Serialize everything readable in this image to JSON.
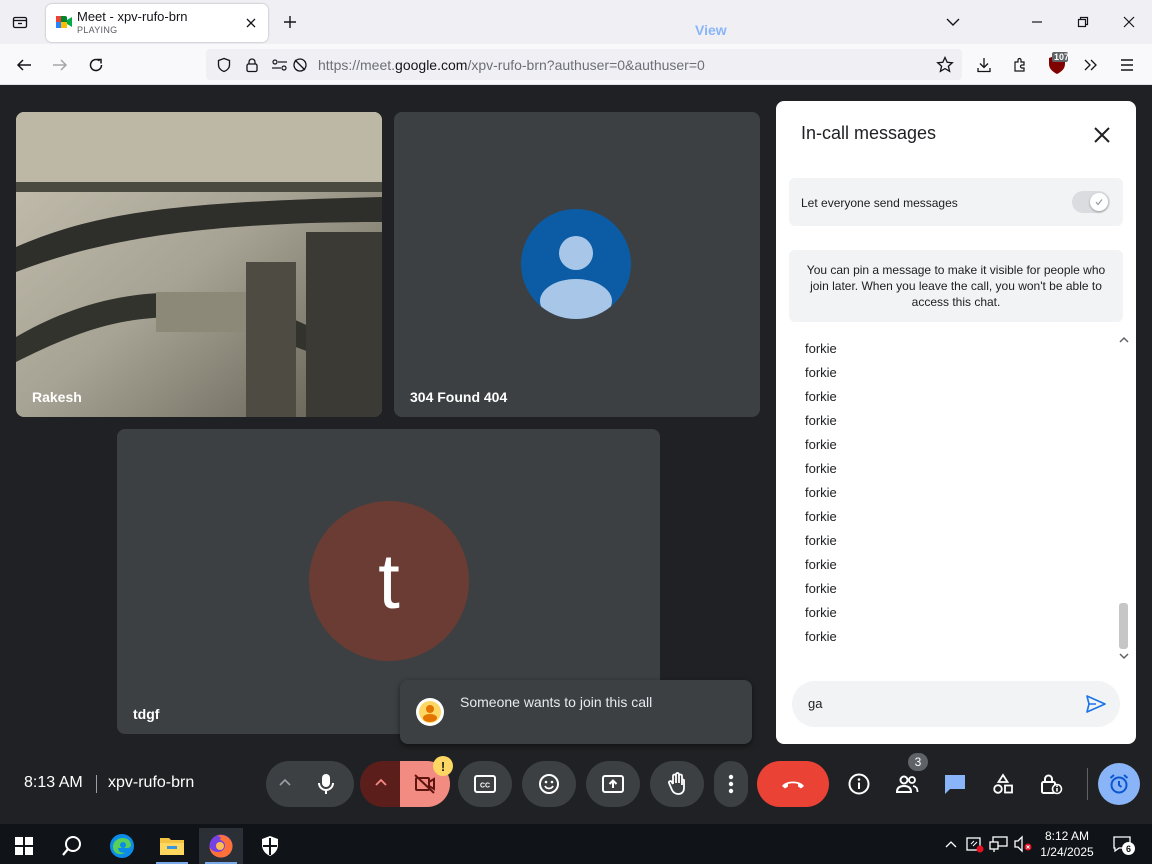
{
  "browser": {
    "tab": {
      "title": "Meet - xpv-rufo-brn",
      "status": "PLAYING"
    },
    "url": {
      "prefix": "https://meet.",
      "host": "google.com",
      "path": "/xpv-rufo-brn?authuser=0&authuser=0"
    },
    "extension_badge": "107"
  },
  "tiles": [
    {
      "name": "Rakesh"
    },
    {
      "name": "304 Found 404"
    },
    {
      "name": "tdgf",
      "initial": "t"
    }
  ],
  "toast": {
    "message": "Someone wants to join this call",
    "action": "View"
  },
  "chat": {
    "title": "In-call messages",
    "setting_label": "Let everyone send messages",
    "setting_enabled": true,
    "pin_info": "You can pin a message to make it visible for people who join later. When you leave the call, you won't be able to access this chat.",
    "messages": [
      "forkie",
      "forkie",
      "forkie",
      "forkie",
      "forkie",
      "forkie",
      "forkie",
      "forkie",
      "forkie",
      "forkie",
      "forkie",
      "forkie",
      "forkie"
    ],
    "input_value": "ga"
  },
  "bottom_bar": {
    "time": "8:13 AM",
    "meeting_code": "xpv-rufo-brn",
    "people_count": "3",
    "camera_warning": "!"
  },
  "taskbar": {
    "time": "8:12 AM",
    "date": "1/24/2025",
    "notifications": "6"
  },
  "colors": {
    "meet_bg": "#202124",
    "tile_bg": "#3c4043",
    "end_call": "#ea4335",
    "camera_off": "#f28b82",
    "accent_blue": "#1a73e8",
    "avatar_blue": "#0b5ca4",
    "avatar_brown": "#6b3c34"
  }
}
